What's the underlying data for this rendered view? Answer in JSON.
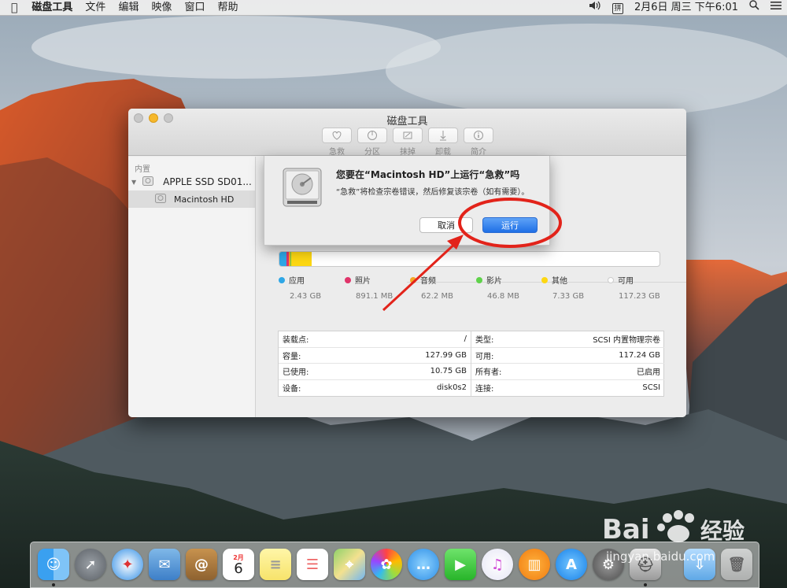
{
  "menubar": {
    "apple_icon": "apple-icon",
    "app_name": "磁盘工具",
    "menus": [
      "文件",
      "编辑",
      "映像",
      "窗口",
      "帮助"
    ],
    "ime": "拼",
    "datetime": "2月6日 周三 下午6:01"
  },
  "window": {
    "title": "磁盘工具",
    "toolbar": [
      {
        "label": "急救",
        "icon": "first-aid-icon"
      },
      {
        "label": "分区",
        "icon": "partition-icon"
      },
      {
        "label": "抹掉",
        "icon": "erase-icon"
      },
      {
        "label": "卸载",
        "icon": "unmount-icon"
      },
      {
        "label": "简介",
        "icon": "info-icon"
      }
    ],
    "sidebar": {
      "section": "内置",
      "disk": "APPLE SSD SD01...",
      "volume": "Macintosh HD"
    },
    "usage": {
      "items": [
        {
          "name": "应用",
          "size": "2.43 GB",
          "color": "#2fa7e6"
        },
        {
          "name": "照片",
          "size": "891.1 MB",
          "color": "#e0346a"
        },
        {
          "name": "音频",
          "size": "62.2 MB",
          "color": "#f5a623"
        },
        {
          "name": "影片",
          "size": "46.8 MB",
          "color": "#5fd24a"
        },
        {
          "name": "其他",
          "size": "7.33 GB",
          "color": "#fdd712"
        },
        {
          "name": "可用",
          "size": "117.23 GB",
          "color": "#ffffff"
        }
      ]
    },
    "info": {
      "left": [
        {
          "label": "装载点:",
          "value": "/"
        },
        {
          "label": "容量:",
          "value": "127.99 GB"
        },
        {
          "label": "已使用:",
          "value": "10.75 GB"
        },
        {
          "label": "设备:",
          "value": "disk0s2"
        }
      ],
      "right": [
        {
          "label": "类型:",
          "value": "SCSI 内置物理宗卷"
        },
        {
          "label": "可用:",
          "value": "117.24 GB"
        },
        {
          "label": "所有者:",
          "value": "已启用"
        },
        {
          "label": "连接:",
          "value": "SCSI"
        }
      ]
    }
  },
  "dialog": {
    "title": "您要在“Macintosh HD”上运行“急救”吗",
    "message": "“急救”将检查宗卷错误，然后修复该宗卷（如有需要）。",
    "cancel": "取消",
    "run": "运行"
  },
  "dock": {
    "apps": [
      "Finder",
      "Launchpad",
      "Safari",
      "Mail",
      "Contacts",
      "Calendar",
      "Notes",
      "Reminders",
      "Maps",
      "Photos",
      "Messages",
      "FaceTime",
      "iTunes",
      "iBooks",
      "App Store",
      "System Preferences",
      "Disk Utility",
      "Downloads",
      "Trash"
    ],
    "calendar_month": "2月",
    "calendar_day": "6"
  },
  "watermark": {
    "brand": "Bai",
    "brand2": "经验",
    "url": "jingyan.baidu.com"
  }
}
